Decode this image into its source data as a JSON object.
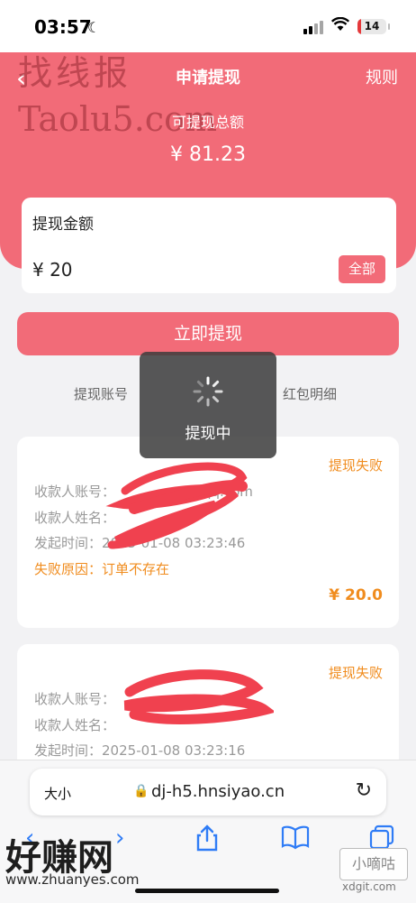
{
  "status_bar": {
    "time": "03:57",
    "battery": "14",
    "battery_level": 0.14
  },
  "header": {
    "title": "申请提现",
    "rules": "规则"
  },
  "summary": {
    "label": "可提现总额",
    "amount": "¥ 81.23"
  },
  "amount_card": {
    "label": "提现金额",
    "value": "¥ 20",
    "all_button": "全部"
  },
  "withdraw_button": "立即提现",
  "links": {
    "account": "提现账号",
    "detail": "红包明细"
  },
  "toast": {
    "text": "提现中"
  },
  "records": [
    {
      "status": "提现失败",
      "account_line": "收款人账号：",
      "account_suffix": "@qq.com",
      "name_line": "收款人姓名：",
      "time_line": "发起时间：",
      "time_value": "2025-01-08 03:23:46",
      "reason_line": "失败原因：订单不存在",
      "amount": "¥ 20.0"
    },
    {
      "status": "提现失败",
      "account_line": "收款人账号：",
      "name_line": "收款人姓名：",
      "time_line": "发起时间：",
      "time_value": "2025-01-08 03:23:16"
    }
  ],
  "browser": {
    "text_size": "大小",
    "url": "dj-h5.hnsiyao.cn"
  },
  "watermarks": {
    "top_text": "找线报",
    "top_site": "Taolu5.com",
    "bottom_text": "好赚网",
    "bottom_url": "www.zhuanyes.com",
    "badge": "小嘀咕",
    "corner": "xdgit.com"
  },
  "colors": {
    "accent": "#f26b78",
    "failure": "#f08c1e",
    "browser_blue": "#2f7cf6"
  },
  "icons": [
    "moon-icon",
    "signal-icon",
    "wifi-icon",
    "back-icon",
    "spinner-icon",
    "lock-icon",
    "reload-icon",
    "share-icon",
    "bookmarks-icon",
    "tabs-icon"
  ]
}
